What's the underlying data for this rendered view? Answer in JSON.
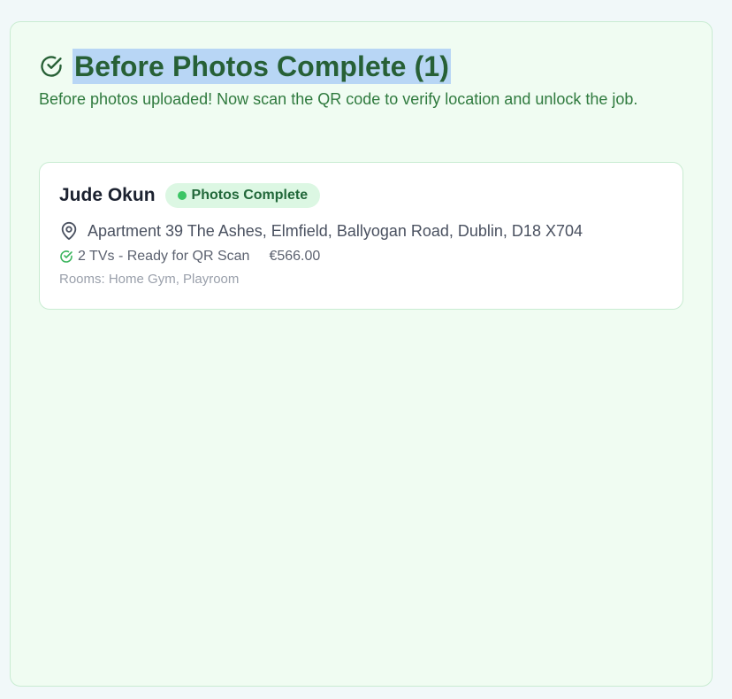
{
  "panel": {
    "title": "Before Photos Complete (1)",
    "description": "Before photos uploaded! Now scan the QR code to verify location and unlock the job.",
    "icon": "circle-check-icon"
  },
  "jobs": [
    {
      "customer_name": "Jude Okun",
      "status": "Photos Complete",
      "address": "Apartment 39 The Ashes, Elmfield, Ballyogan Road, Dublin, D18 X704",
      "tv_status": "2 TVs - Ready for QR Scan",
      "price": "€566.00",
      "rooms": "Rooms: Home Gym, Playroom"
    }
  ],
  "colors": {
    "panel_bg": "#f0fcf2",
    "panel_border": "#c9ecd2",
    "title_color": "#276036",
    "title_highlight": "#b8d6f5",
    "badge_bg": "#dcf7e3",
    "badge_dot": "#3cc565"
  }
}
